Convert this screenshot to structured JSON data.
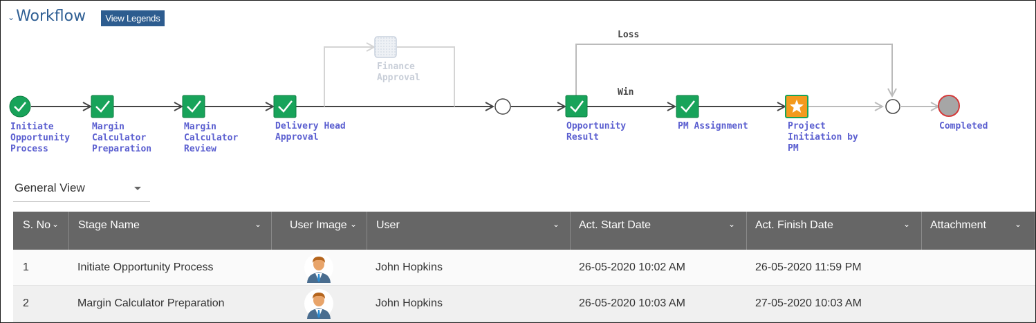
{
  "workflow": {
    "title": "Workflow",
    "legend_button": "View Legends",
    "nodes": [
      {
        "label": "Initiate\nOpportunity\nProcess",
        "status": "completed"
      },
      {
        "label": "Margin\nCalculator\nPreparation",
        "status": "completed"
      },
      {
        "label": "Margin\nCalculator\nReview",
        "status": "completed"
      },
      {
        "label": "Delivery Head\nApproval",
        "status": "completed"
      },
      {
        "label": "Finance\nApproval",
        "status": "skipped"
      },
      {
        "label": "Opportunity\nResult",
        "status": "completed"
      },
      {
        "label": "PM Assignment",
        "status": "completed"
      },
      {
        "label": "Project\nInitiation by\nPM",
        "status": "in-progress"
      },
      {
        "label": "Completed",
        "status": "end"
      }
    ],
    "edges": {
      "loss": "Loss",
      "win": "Win"
    },
    "colors": {
      "completed": "#18a35a",
      "in_progress": "#f39a1e",
      "end": "#d43a3a",
      "link": "#5b5fd0"
    }
  },
  "view_select": {
    "value": "General View"
  },
  "table": {
    "columns": [
      "S. No",
      "Stage Name",
      "User Image",
      "User",
      "Act. Start Date",
      "Act. Finish Date",
      "Attachment"
    ],
    "rows": [
      {
        "sno": "1",
        "stage": "Initiate Opportunity Process",
        "user": "John Hopkins",
        "start": "26-05-2020 10:02 AM",
        "finish": "26-05-2020 11:59 PM",
        "attachment": ""
      },
      {
        "sno": "2",
        "stage": "Margin Calculator Preparation",
        "user": "John Hopkins",
        "start": "26-05-2020 10:03 AM",
        "finish": "27-05-2020 10:03 AM",
        "attachment": ""
      }
    ]
  }
}
